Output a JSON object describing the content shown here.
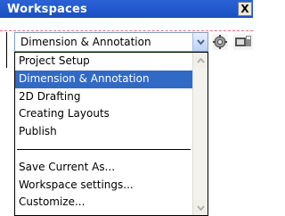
{
  "window": {
    "title": "Workspaces",
    "close_label": "X"
  },
  "combo": {
    "value": "Dimension & Annotation"
  },
  "toolbar": {
    "icons": [
      "gear-icon",
      "workspace-settings-icon"
    ]
  },
  "dropdown": {
    "items": [
      {
        "label": "Project Setup",
        "selected": false
      },
      {
        "label": "Dimension & Annotation",
        "selected": true
      },
      {
        "label": "2D Drafting",
        "selected": false
      },
      {
        "label": "Creating Layouts",
        "selected": false
      },
      {
        "label": "Publish",
        "selected": false
      }
    ],
    "actions": [
      {
        "label": "Save Current As..."
      },
      {
        "label": "Workspace settings..."
      },
      {
        "label": "Customize..."
      }
    ]
  },
  "colors": {
    "titlebar": "#1b4fc2",
    "selection": "#316ac5",
    "dash": "#e07070"
  }
}
